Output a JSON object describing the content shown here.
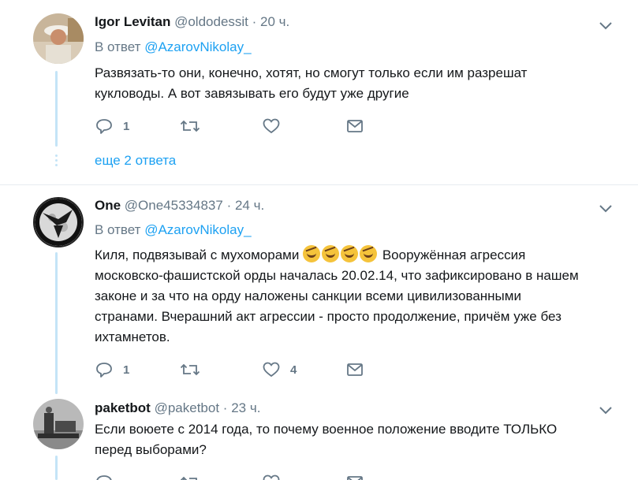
{
  "tweets": [
    {
      "name": "Igor Levitan",
      "handle": "@oldodessit",
      "dot": "·",
      "time": "20 ч.",
      "reply_prefix": "В ответ",
      "reply_mention": "@AzarovNikolay_",
      "text_line1": "Развязать-то они, конечно, хотят, но смогут только если им разрешат",
      "text_line2": "кукловоды. А вот завязывать его будут уже другие",
      "reply_count": "1",
      "retweet_count": "",
      "like_count": "",
      "more_replies": "еще 2 ответа"
    },
    {
      "name": "One",
      "handle": "@One45334837",
      "dot": "·",
      "time": "24 ч.",
      "reply_prefix": "В ответ",
      "reply_mention": "@AzarovNikolay_",
      "text_line1_pre": "Киля, подвязывай с мухоморами",
      "text_line1_post": "Вооружённая агрессия",
      "text_line2": "московско-фашистской орды началась 20.02.14, что зафиксировано в нашем",
      "text_line3": "законе и за что на орду наложены санкции всеми цивилизованными",
      "text_line4": "странами. Вчерашний акт агрессии - просто продолжение, причём уже без",
      "text_line5": "ихтамнетов.",
      "reply_count": "1",
      "retweet_count": "",
      "like_count": "4"
    },
    {
      "name": "paketbot",
      "handle": "@paketbot",
      "dot": "·",
      "time": "23 ч.",
      "text_line1": "Если воюете с 2014 года, то почему  военное положение вводите ТОЛЬКО",
      "text_line2": "перед выборами?"
    }
  ],
  "icons": {
    "reply": "reply-icon",
    "retweet": "retweet-icon",
    "like": "heart-icon",
    "dm": "envelope-icon",
    "menu": "chevron-down-icon",
    "emoji": "rolling-laughing-emoji"
  },
  "colors": {
    "link": "#1da1f2",
    "muted": "#657786",
    "thread": "#c4e4f7"
  }
}
